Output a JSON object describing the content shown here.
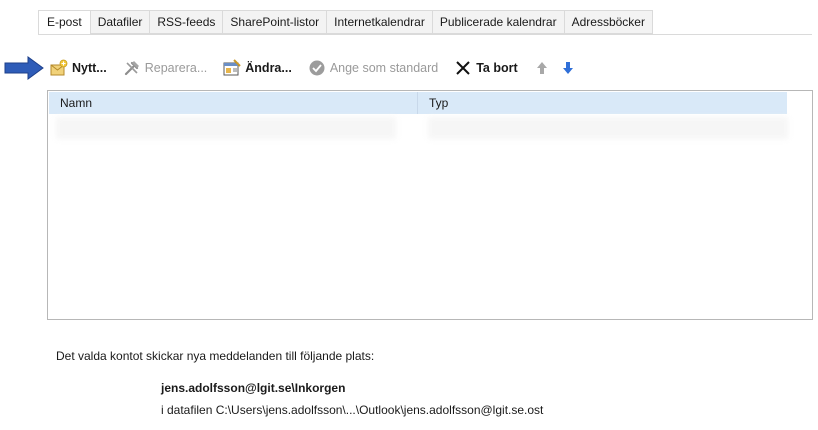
{
  "tabs": [
    {
      "label": "E-post",
      "active": true
    },
    {
      "label": "Datafiler",
      "active": false
    },
    {
      "label": "RSS-feeds",
      "active": false
    },
    {
      "label": "SharePoint-listor",
      "active": false
    },
    {
      "label": "Internetkalendrar",
      "active": false
    },
    {
      "label": "Publicerade kalendrar",
      "active": false
    },
    {
      "label": "Adressböcker",
      "active": false
    }
  ],
  "toolbar": {
    "new_label": "Nytt...",
    "repair_label": "Reparera...",
    "change_label": "Ändra...",
    "set_default_label": "Ange som standard",
    "remove_label": "Ta bort",
    "move_up_icon": "arrow-up-icon",
    "move_down_icon": "arrow-down-icon"
  },
  "list": {
    "columns": [
      "Namn",
      "Typ"
    ]
  },
  "delivery": {
    "info_text": "Det valda kontot skickar nya meddelanden till följande plats:",
    "location": "jens.adolfsson@lgit.se\\Inkorgen",
    "data_file": "i datafilen C:\\Users\\jens.adolfsson\\...\\Outlook\\jens.adolfsson@lgit.se.ost"
  },
  "colors": {
    "header_bg": "#d9e9f8",
    "pointer_arrow": "#2e5cb8",
    "arrow_up": "#a8a8a8",
    "arrow_down": "#2f6fd8"
  }
}
